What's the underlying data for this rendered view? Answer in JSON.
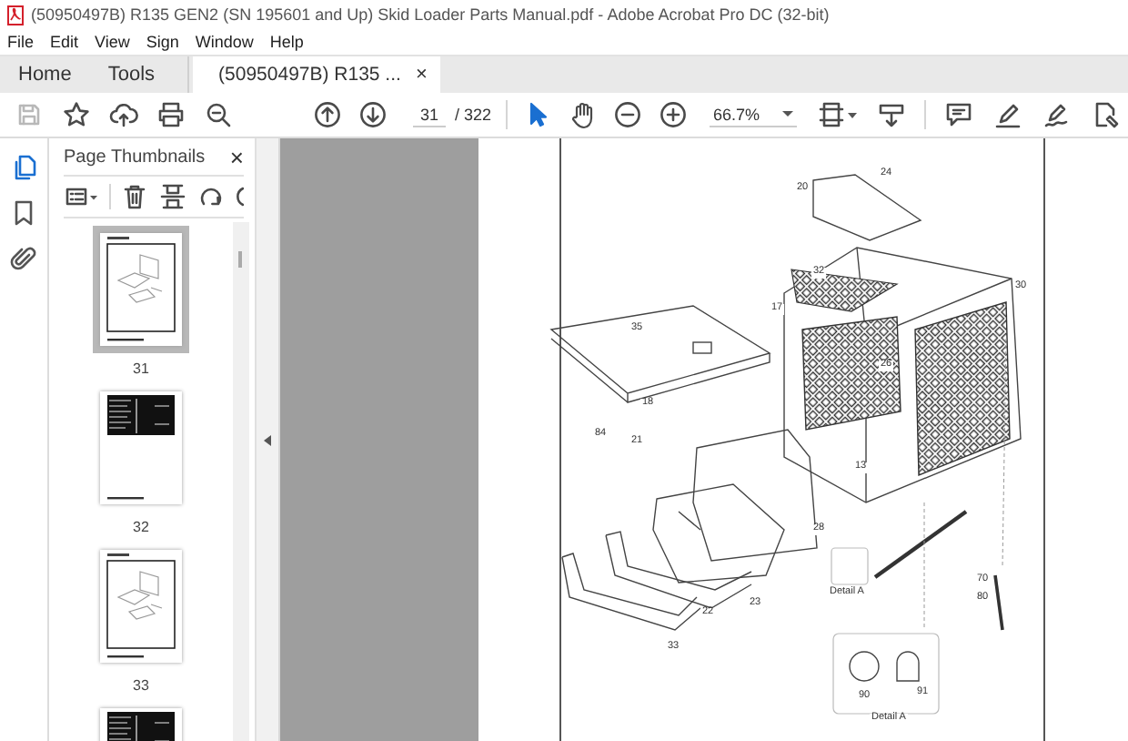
{
  "window": {
    "title": "(50950497B) R135 GEN2 (SN 195601 and Up) Skid Loader Parts Manual.pdf - Adobe Acrobat Pro DC (32-bit)"
  },
  "menu": [
    "File",
    "Edit",
    "View",
    "Sign",
    "Window",
    "Help"
  ],
  "tabs": [
    {
      "label": "Home",
      "selected": false,
      "kind": "plain"
    },
    {
      "label": "Tools",
      "selected": false,
      "kind": "plain"
    },
    {
      "label": "(50950497B) R135 ...",
      "selected": true,
      "kind": "document",
      "close": "×"
    }
  ],
  "toolbar": {
    "save_disabled": true,
    "page_number": "31",
    "page_count": "/ 322",
    "zoom": "66.7%",
    "tools": [
      {
        "kind": "select",
        "selected": true
      },
      {
        "kind": "hand",
        "selected": false
      }
    ]
  },
  "sidebar": {
    "rail": [
      {
        "kind": "pages",
        "selected": true
      },
      {
        "kind": "bookmarks",
        "selected": false
      },
      {
        "kind": "attachments",
        "selected": false
      }
    ],
    "panel_title": "Page Thumbnails",
    "close": "×",
    "thumbnails": [
      {
        "label": "31",
        "kind": "drawing",
        "selected": true
      },
      {
        "label": "32",
        "kind": "table",
        "selected": false
      },
      {
        "label": "33",
        "kind": "drawing",
        "selected": false
      },
      {
        "kind": "table",
        "selected": false
      }
    ]
  },
  "document": {
    "callouts": [
      "24",
      "20",
      "32",
      "30",
      "17",
      "35",
      "26",
      "18",
      "84",
      "21",
      "13",
      "28",
      "Detail A",
      "70",
      "80",
      "23",
      "22",
      "33",
      "90",
      "91",
      "Detail A"
    ]
  }
}
